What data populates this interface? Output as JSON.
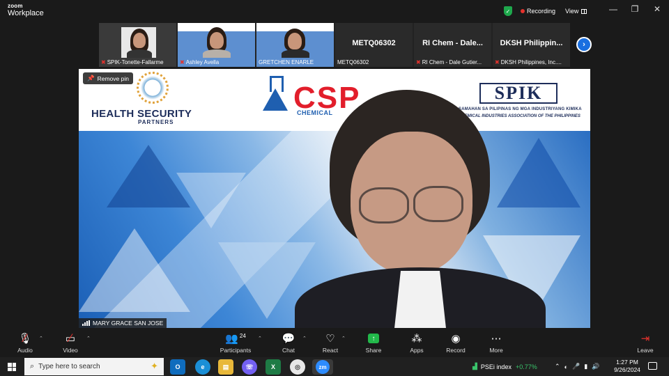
{
  "app": {
    "brand_line1": "zoom",
    "brand_line2": "Workplace"
  },
  "titlebar": {
    "recording_label": "Recording",
    "view_label": "View",
    "minimize": "—",
    "restore": "❐",
    "close": "✕"
  },
  "thumbnails": [
    {
      "name": "SPIK-Tonette-Fallarme",
      "type": "video"
    },
    {
      "name": "Ashley Avella",
      "type": "video"
    },
    {
      "name": "GRETCHEN ENARLE",
      "type": "video"
    },
    {
      "name": "METQ06302",
      "big_label": "METQ06302",
      "type": "name"
    },
    {
      "name": "RI Chem - Dale Gutier...",
      "big_label": "RI Chem - Dale...",
      "type": "name"
    },
    {
      "name": "DKSH Philippines, Inc....",
      "big_label": "DKSH Philippin...",
      "type": "name"
    }
  ],
  "main_video": {
    "remove_pin_label": "Remove pin",
    "speaker_name": "MARY GRACE SAN JOSE",
    "banner": {
      "hsp_title": "HEALTH SECURITY",
      "hsp_sub": "PARTNERS",
      "csp_logo": "CSP",
      "csp_sub": "CHEMICAL",
      "spik_logo": "SPIK",
      "spik_sub1": "SAMAHAN SA PILIPINAS NG MGA INDUSTRIYANG KIMIKA",
      "spik_sub2": "CHEMICAL INDUSTRIES ASSOCIATION OF THE PHILIPPINES"
    }
  },
  "toolbar": {
    "audio": "Audio",
    "video": "Video",
    "participants": "Participants",
    "participants_count": "24",
    "chat": "Chat",
    "react": "React",
    "share": "Share",
    "apps": "Apps",
    "record": "Record",
    "more": "More",
    "leave": "Leave"
  },
  "taskbar": {
    "search_placeholder": "Type here to search",
    "stock_name": "PSEi index",
    "stock_change": "+0.77%",
    "time": "1:27 PM",
    "date": "9/26/2024"
  },
  "colors": {
    "accent": "#1a6fe0",
    "recording": "#e5322d",
    "share_green": "#22b84a",
    "stock_up": "#39c46b"
  }
}
